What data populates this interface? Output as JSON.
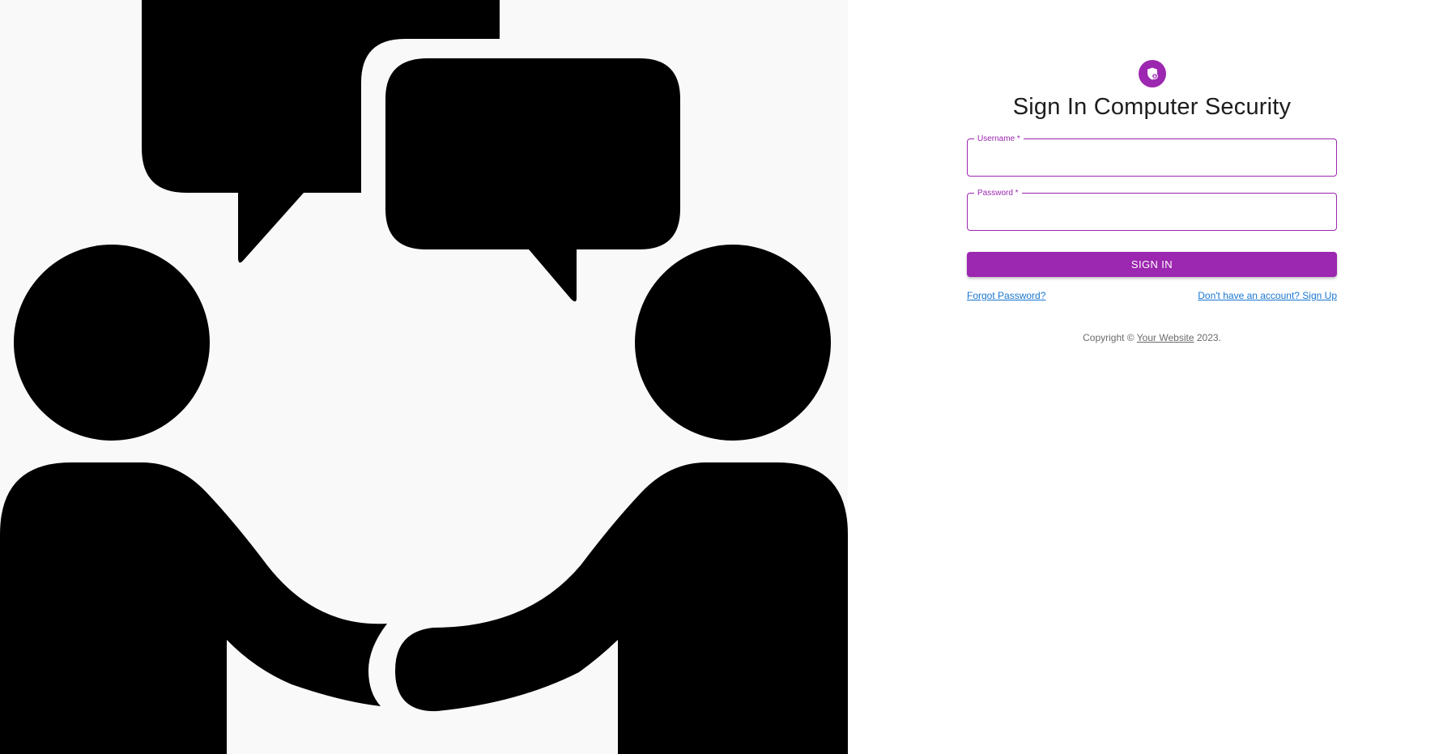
{
  "theme": {
    "accent": "#9c27b0",
    "link": "#1976d2"
  },
  "illustration": {
    "icon": "two-people-conversation-handshake"
  },
  "form": {
    "avatar_icon": "shield-lock-icon",
    "title": "Sign In Computer Security",
    "username": {
      "label": "Username *",
      "value": "",
      "placeholder": ""
    },
    "password": {
      "label": "Password *",
      "value": "",
      "placeholder": ""
    },
    "submit_label": "SIGN IN",
    "forgot_password": "Forgot Password?",
    "sign_up": "Don't have an account? Sign Up"
  },
  "footer": {
    "copyright_prefix": "Copyright ©",
    "website_link": "Your Website",
    "year_suffix": "2023."
  }
}
